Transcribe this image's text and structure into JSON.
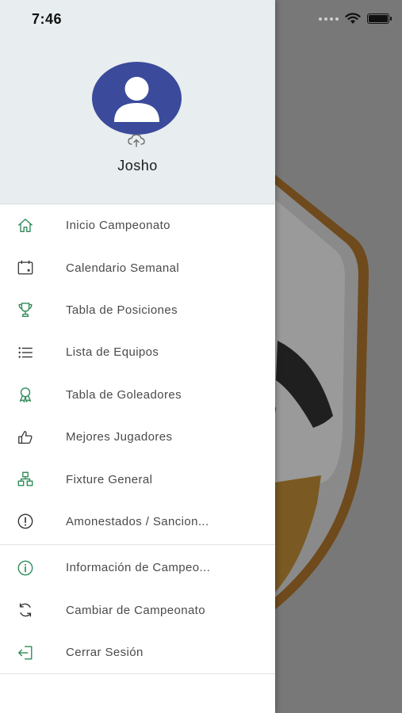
{
  "status_bar": {
    "time": "7:46"
  },
  "user": {
    "name": "Josho"
  },
  "colors": {
    "accent": "#2e8b57",
    "avatar_bg": "#3b4a9b",
    "header_bg": "#e8edef"
  },
  "menu_main": [
    {
      "label": "Inicio Campeonato",
      "icon": "home-icon"
    },
    {
      "label": "Calendario Semanal",
      "icon": "calendar-icon"
    },
    {
      "label": "Tabla de Posiciones",
      "icon": "trophy-icon"
    },
    {
      "label": "Lista de Equipos",
      "icon": "list-icon"
    },
    {
      "label": "Tabla de Goleadores",
      "icon": "award-icon"
    },
    {
      "label": "Mejores Jugadores",
      "icon": "thumbs-up-icon"
    },
    {
      "label": "Fixture General",
      "icon": "fixture-icon"
    },
    {
      "label": "Amonestados / Sancion...",
      "icon": "alert-icon"
    }
  ],
  "menu_secondary": [
    {
      "label": "Información de Campeo...",
      "icon": "info-icon"
    },
    {
      "label": "Cambiar de Campeonato",
      "icon": "refresh-icon"
    },
    {
      "label": "Cerrar Sesión",
      "icon": "logout-icon"
    }
  ]
}
